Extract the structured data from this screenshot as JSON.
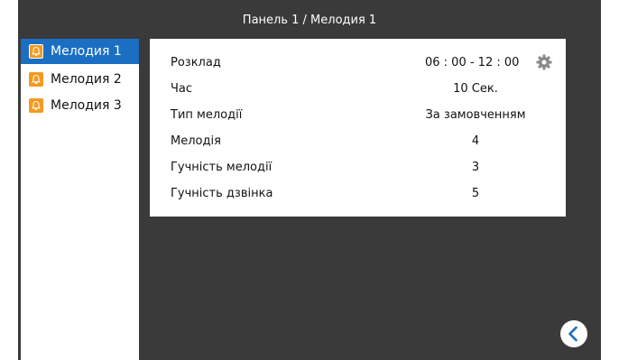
{
  "header": {
    "title": "Панель 1 / Мелодия 1"
  },
  "sidebar": {
    "items": [
      {
        "label": "Мелодия  1",
        "active": true
      },
      {
        "label": "Мелодия  2",
        "active": false
      },
      {
        "label": "Мелодия  3",
        "active": false
      }
    ]
  },
  "settings": {
    "rows": [
      {
        "label": "Розклад",
        "value": "06 : 00 - 12 : 00"
      },
      {
        "label": "Час",
        "value": "10 Сек."
      },
      {
        "label": "Тип мелодії",
        "value": "За замовченням"
      },
      {
        "label": "Мелодія",
        "value": "4"
      },
      {
        "label": "Гучність мелодії",
        "value": "3"
      },
      {
        "label": "Гучність дзвінка",
        "value": "5"
      }
    ]
  },
  "icons": {
    "bell": "bell-icon",
    "gear": "gear-icon",
    "back": "back-arrow-icon"
  },
  "colors": {
    "accent": "#1a6fc2",
    "bell": "#f39a1f",
    "background": "#3a3a3a"
  }
}
